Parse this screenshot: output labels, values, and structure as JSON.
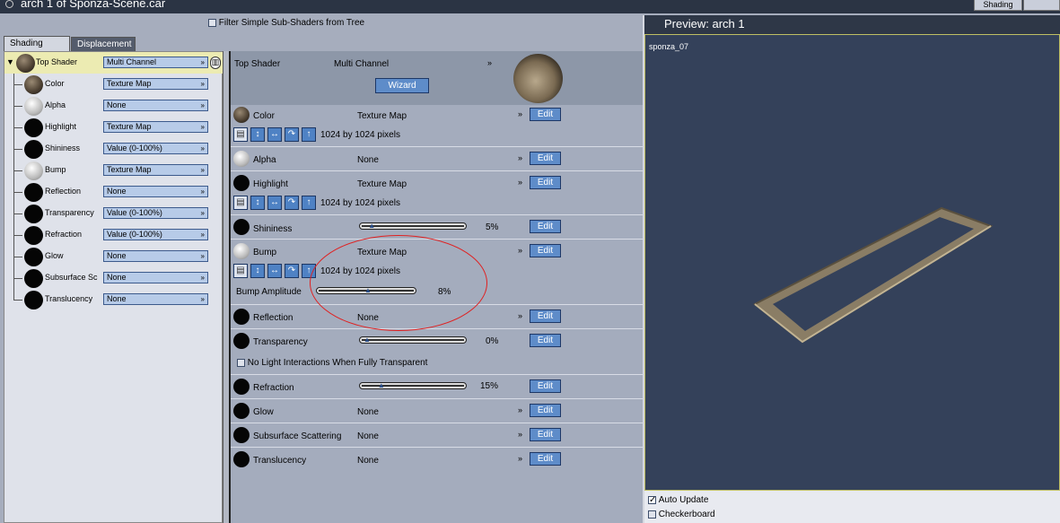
{
  "window": {
    "title": "arch 1 of Sponza-Scene.car",
    "top_tab": "Shading"
  },
  "filter": {
    "label": "Filter Simple Sub-Shaders from Tree",
    "checked": false
  },
  "tabs": [
    {
      "label": "Shading",
      "active": true
    },
    {
      "label": "Displacement",
      "active": false
    }
  ],
  "tree": {
    "items": [
      {
        "label": "Top Shader",
        "value": "Multi Channel"
      },
      {
        "label": "Color",
        "value": "Texture Map"
      },
      {
        "label": "Alpha",
        "value": "None"
      },
      {
        "label": "Highlight",
        "value": "Texture Map"
      },
      {
        "label": "Shininess",
        "value": "Value (0-100%)"
      },
      {
        "label": "Bump",
        "value": "Texture Map"
      },
      {
        "label": "Reflection",
        "value": "None"
      },
      {
        "label": "Transparency",
        "value": "Value (0-100%)"
      },
      {
        "label": "Refraction",
        "value": "Value (0-100%)"
      },
      {
        "label": "Glow",
        "value": "None"
      },
      {
        "label": "Subsurface Sc",
        "value": "None"
      },
      {
        "label": "Translucency",
        "value": "None"
      }
    ]
  },
  "main": {
    "top": {
      "label": "Top Shader",
      "value": "Multi Channel",
      "wizard_label": "Wizard"
    },
    "edit_label": "Edit",
    "rows": {
      "color": {
        "name": "Color",
        "value": "Texture Map",
        "pixels": "1024 by 1024 pixels"
      },
      "alpha": {
        "name": "Alpha",
        "value": "None"
      },
      "highlight": {
        "name": "Highlight",
        "value": "Texture Map",
        "pixels": "1024 by 1024 pixels"
      },
      "shininess": {
        "name": "Shininess",
        "percent": "5%",
        "level": 0.05
      },
      "bump": {
        "name": "Bump",
        "value": "Texture Map",
        "pixels": "1024 by 1024 pixels",
        "amplitude_label": "Bump Amplitude",
        "amplitude_percent": "8%",
        "level": 0.5
      },
      "reflection": {
        "name": "Reflection",
        "value": "None"
      },
      "transparency": {
        "name": "Transparency",
        "percent": "0%",
        "level": 0.0,
        "no_light_label": "No Light Interactions When Fully Transparent"
      },
      "refraction": {
        "name": "Refraction",
        "percent": "15%",
        "level": 0.15
      },
      "glow": {
        "name": "Glow",
        "value": "None"
      },
      "subsurface": {
        "name": "Subsurface Scattering",
        "value": "None"
      },
      "translucency": {
        "name": "Translucency",
        "value": "None"
      }
    }
  },
  "preview": {
    "title": "Preview: arch 1",
    "material_label": "sponza_07",
    "auto_update_label": "Auto Update",
    "auto_update_checked": true,
    "checkerboard_label": "Checkerboard",
    "checkerboard_checked": false
  }
}
